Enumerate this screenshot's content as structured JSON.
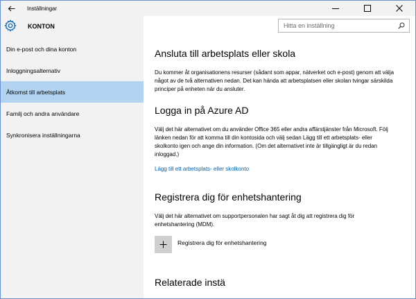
{
  "titlebar": {
    "title": "Inställningar",
    "back_icon": "back-arrow-icon",
    "controls": [
      "minimize-icon",
      "maximize-icon",
      "close-icon"
    ]
  },
  "header": {
    "title": "KONTON",
    "icon": "gear-icon"
  },
  "search": {
    "placeholder": "Hitta en inställning",
    "icon": "search-icon"
  },
  "sidebar": {
    "items": [
      {
        "label": "Din e-post och dina konton",
        "active": false
      },
      {
        "label": "Inloggningsalternativ",
        "active": false
      },
      {
        "label": "Åtkomst till arbetsplats",
        "active": true
      },
      {
        "label": "Familj och andra användare",
        "active": false
      },
      {
        "label": "Synkronisera inställningarna",
        "active": false
      }
    ]
  },
  "main": {
    "section1": {
      "heading": "Ansluta till arbetsplats eller skola",
      "body": "Du kommer åt organisationens resurser (sådant som appar, nätverket och e-post) genom att välja något av de två alternativen nedan. Det kan hända att arbetsplatsen eller skolan tvingar särskilda principer på enheten när du ansluter."
    },
    "section2": {
      "heading": "Logga in på Azure AD",
      "body": "Välj det här alternativet om du använder Office 365 eller andra affärstjänster från Microsoft. Följ länken nedan för att komma till din kontosida och välj sedan Lägg till ett arbetsplats- eller skolkonto igen och ange din information. (Om det alternativet inte är tillgängligt är du redan inloggad.)",
      "link": "Lägg till ett arbetsplats- eller skolkonto"
    },
    "section3": {
      "heading": "Registrera dig för enhetshantering",
      "body": "Välj det här alternativet om supportpersonalen har sagt åt dig att registrera dig för enhetshantering (MDM).",
      "button_label": "Registrera dig för enhetshantering",
      "button_icon": "plus-icon"
    },
    "section4": {
      "heading": "Relaterade instä"
    }
  },
  "colors": {
    "sidebar_bg": "#f2f2f2",
    "active_item": "#b3d4f0",
    "link": "#0063b1",
    "add_button": "#cfcfcf",
    "accent": "#0063b1"
  }
}
